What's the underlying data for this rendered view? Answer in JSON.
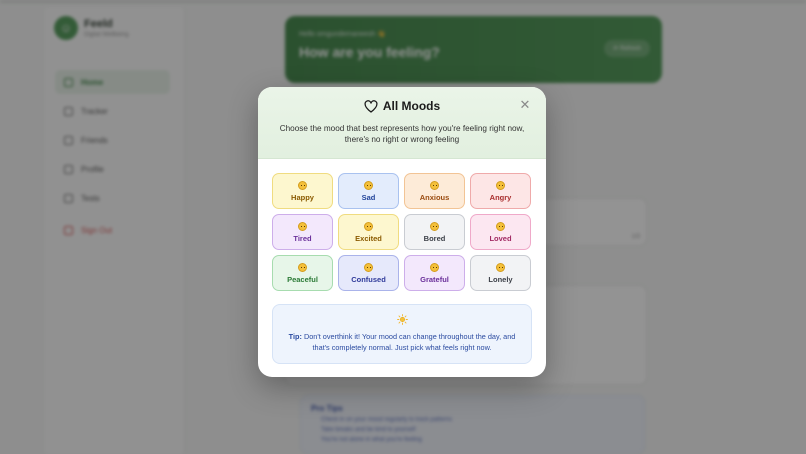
{
  "app": {
    "brand_name": "Feeld",
    "brand_sub": "Digital Wellbeing",
    "nav": [
      {
        "label": "Home",
        "icon": "home-icon",
        "active": true
      },
      {
        "label": "Tracker",
        "icon": "calendar-icon"
      },
      {
        "label": "Friends",
        "icon": "users-icon"
      },
      {
        "label": "Profile",
        "icon": "user-icon"
      },
      {
        "label": "Tests",
        "icon": "heart-icon"
      }
    ],
    "signout_label": "Sign Out",
    "hero": {
      "hello": "Hello omgundernaneesh 👋",
      "title": "How are you feeling?",
      "button": "⟳ Refresh"
    },
    "progress_label": "1/3",
    "tips": {
      "title": "Pro Tips",
      "lines": [
        "Check in on your mood regularly to track patterns",
        "Take breaks and be kind to yourself",
        "You're not alone in what you're feeling"
      ]
    }
  },
  "modal": {
    "title": "All Moods",
    "subtitle": "Choose the mood that best represents how you're feeling right now, there's no right or wrong feeling",
    "close_icon": "close-icon",
    "moods": [
      {
        "label": "Happy",
        "emoji": "😊",
        "bg": "#fdf7cf",
        "border": "#f0dc80",
        "color": "#8a5a00"
      },
      {
        "label": "Sad",
        "emoji": "😢",
        "bg": "#e3ecfc",
        "border": "#a9c2ef",
        "color": "#23449a"
      },
      {
        "label": "Anxious",
        "emoji": "😰",
        "bg": "#fdebd8",
        "border": "#f2c495",
        "color": "#9a4b0f"
      },
      {
        "label": "Angry",
        "emoji": "😠",
        "bg": "#fde6e6",
        "border": "#efaaaa",
        "color": "#a92d2d"
      },
      {
        "label": "Tired",
        "emoji": "😴",
        "bg": "#f3e8fc",
        "border": "#cdaeea",
        "color": "#6a2f9a"
      },
      {
        "label": "Excited",
        "emoji": "🤩",
        "bg": "#fdf7cf",
        "border": "#f0dc80",
        "color": "#8a5a00"
      },
      {
        "label": "Bored",
        "emoji": "😑",
        "bg": "#f2f3f5",
        "border": "#c9ccd2",
        "color": "#3b3f47"
      },
      {
        "label": "Loved",
        "emoji": "🥰",
        "bg": "#fce7f1",
        "border": "#efa9c9",
        "color": "#a22a63"
      },
      {
        "label": "Peaceful",
        "emoji": "😌",
        "bg": "#e7f6e9",
        "border": "#a7dcaf",
        "color": "#2b7a36"
      },
      {
        "label": "Confused",
        "emoji": "😕",
        "bg": "#e6e9fb",
        "border": "#aab3ea",
        "color": "#2f3a9a"
      },
      {
        "label": "Grateful",
        "emoji": "🙏",
        "bg": "#f3e8fc",
        "border": "#cdaeea",
        "color": "#6a2f9a"
      },
      {
        "label": "Lonely",
        "emoji": "😔",
        "bg": "#f2f3f5",
        "border": "#c9ccd2",
        "color": "#3b3f47"
      }
    ],
    "tip": {
      "icon": "sun-icon",
      "prefix": "Tip:",
      "text": "Don't overthink it! Your mood can change throughout the day, and that's completely normal. Just pick what feels right now."
    }
  },
  "colors": {
    "brand_green": "#3f8f47",
    "tip_blue": "#2a4aa0"
  }
}
